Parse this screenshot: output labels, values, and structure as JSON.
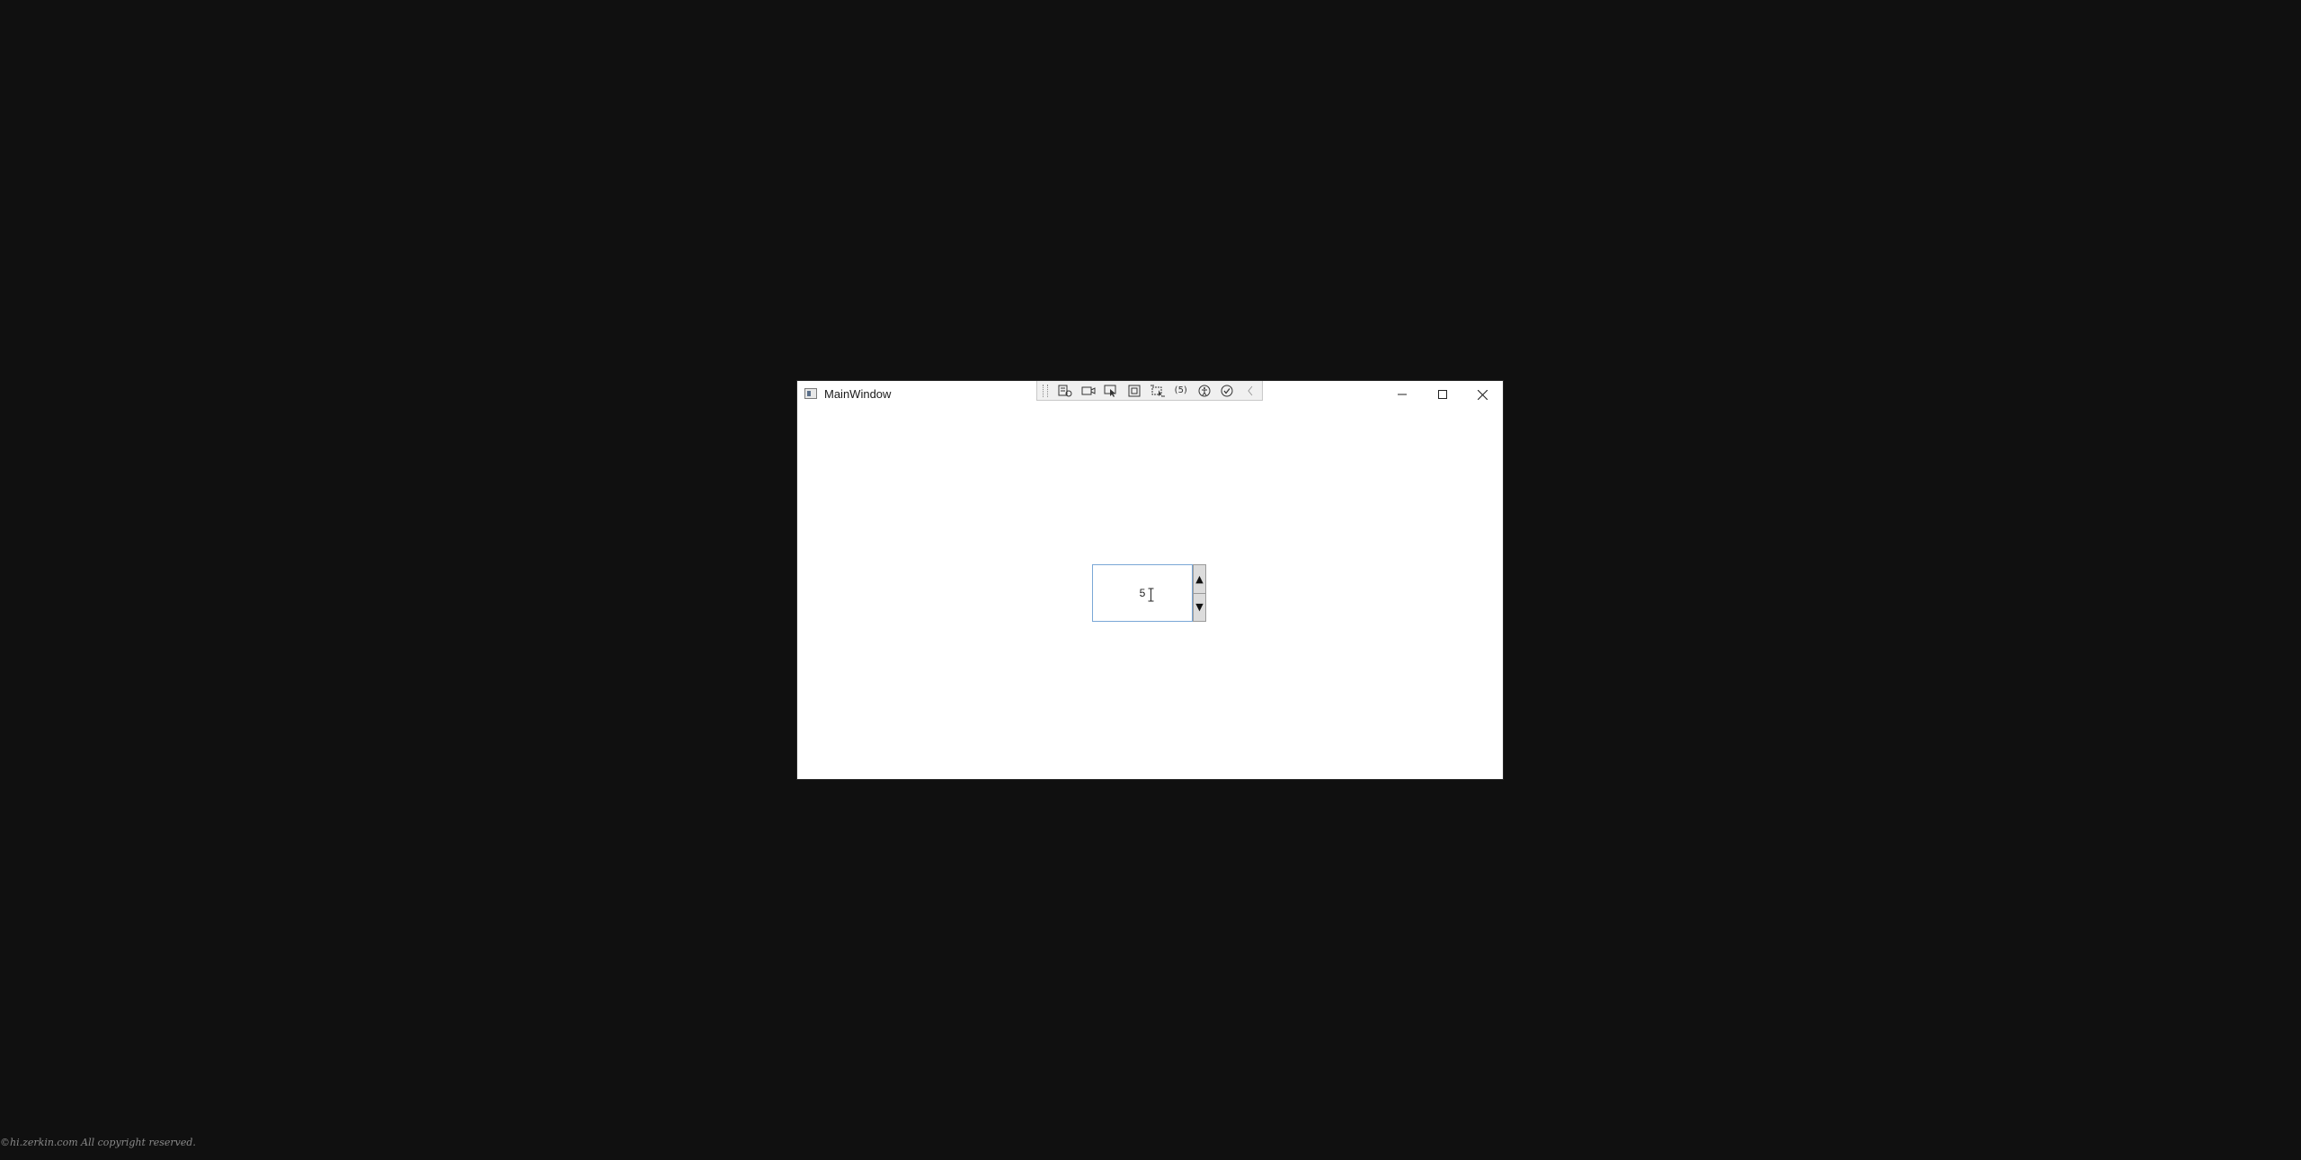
{
  "window": {
    "title": "MainWindow",
    "controls": {
      "minimize": "–",
      "maximize": "☐",
      "close": "✕"
    }
  },
  "debug_toolbar": {
    "items": [
      {
        "name": "live-visual-tree",
        "icon": "visual-tree-icon"
      },
      {
        "name": "select-element",
        "icon": "camera-icon"
      },
      {
        "name": "select-in-app",
        "icon": "pointer-select-icon"
      },
      {
        "name": "display-layout-adorners",
        "icon": "adorner-icon"
      },
      {
        "name": "track-focused-element",
        "icon": "focus-track-icon"
      },
      {
        "name": "binding-failures",
        "label": "(5)",
        "icon": "binding-icon"
      },
      {
        "name": "accessibility",
        "icon": "accessibility-icon"
      },
      {
        "name": "hot-reload",
        "icon": "check-circle-icon"
      },
      {
        "name": "collapse",
        "icon": "chevron-left-icon"
      }
    ],
    "binding_label": "(5)"
  },
  "numeric_updown": {
    "value": "5",
    "up_glyph": "▲",
    "down_glyph": "▼"
  },
  "footer": {
    "copyright": "©hi.zerkin.com All copyright reserved."
  }
}
